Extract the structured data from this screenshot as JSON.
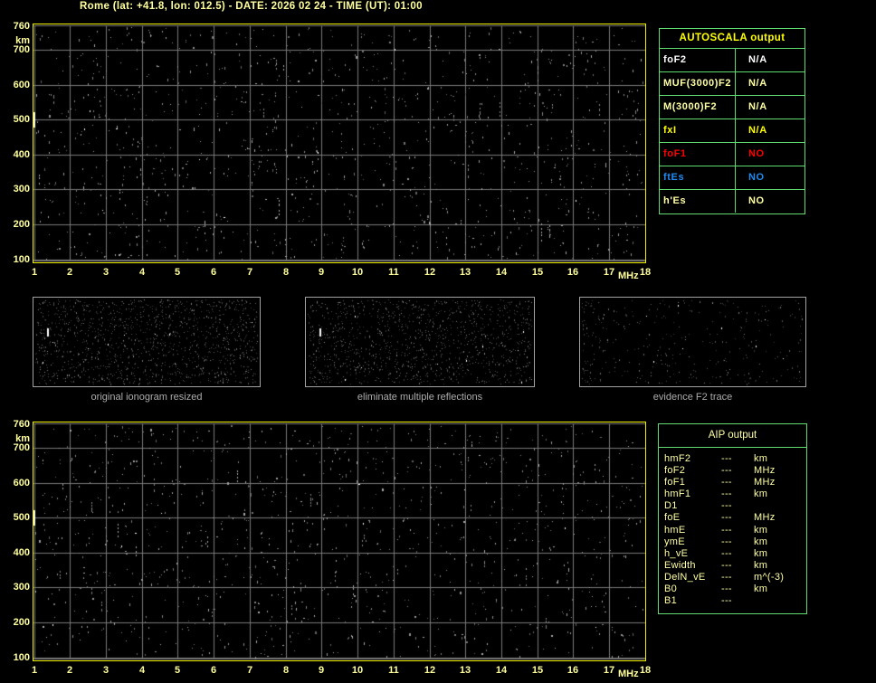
{
  "window": {
    "title": "Rome (lat: +41.8, lon: 012.5) - DATE: 2026 02 24 - TIME (UT): 01:00",
    "background": "#000000"
  },
  "colors": {
    "title_yellow": "#ffff9c",
    "axis_yellow": "#ffff9c",
    "plot_border_yellow": "#f2f200",
    "grid_gray": "#7a7a7a",
    "table_border_green": "#5fdb6f",
    "bright_yellow": "#ffff00",
    "pale_yellow": "#ffffa4",
    "white": "#ffffff",
    "red": "#ff0000",
    "blue": "#1e8cf0",
    "panel_gray": "#a2a2a2",
    "panel_label_gray": "#adadad"
  },
  "chart_data": [
    {
      "name": "top_ionogram",
      "type": "scatter",
      "title": "",
      "xlabel": "MHz",
      "ylabel": "km",
      "x_ticks": [
        1,
        2,
        3,
        4,
        5,
        6,
        7,
        8,
        9,
        10,
        11,
        12,
        13,
        14,
        15,
        16,
        17,
        18
      ],
      "y_ticks": [
        760,
        700,
        600,
        500,
        400,
        300,
        200,
        100
      ],
      "xlim": [
        1,
        18
      ],
      "ylim_km": [
        90,
        768
      ],
      "grid": true,
      "content": "random receiver noise echoes, no identifiable ionospheric trace",
      "noise": {
        "seed": 20260224,
        "count": 1150,
        "streaks": 26,
        "bright": 10
      }
    },
    {
      "name": "bottom_ionogram",
      "type": "scatter",
      "title": "",
      "xlabel": "MHz",
      "ylabel": "km",
      "x_ticks": [
        1,
        2,
        3,
        4,
        5,
        6,
        7,
        8,
        9,
        10,
        11,
        12,
        13,
        14,
        15,
        16,
        17,
        18
      ],
      "y_ticks": [
        760,
        700,
        600,
        500,
        400,
        300,
        200,
        100
      ],
      "xlim": [
        1,
        18
      ],
      "ylim_km": [
        90,
        768
      ],
      "grid": true,
      "content": "random receiver noise echoes, no identifiable ionospheric trace",
      "noise": {
        "seed": 77130355,
        "count": 1100,
        "streaks": 24,
        "bright": 9
      }
    }
  ],
  "autoscala_table": {
    "title": "AUTOSCALA output",
    "rows": [
      {
        "param": "foF2",
        "value": "N/A",
        "color": "#ffffff"
      },
      {
        "param": "MUF(3000)F2",
        "value": "N/A",
        "color": "#ffffa4"
      },
      {
        "param": "M(3000)F2",
        "value": "N/A",
        "color": "#ffffa4"
      },
      {
        "param": "fxI",
        "value": "N/A",
        "color": "#ffff00"
      },
      {
        "param": "foF1",
        "value": "NO",
        "color": "#ff0000"
      },
      {
        "param": "ftEs",
        "value": "NO",
        "color": "#1e8cf0"
      },
      {
        "param": "h'Es",
        "value": "NO",
        "color": "#ffffa4"
      }
    ]
  },
  "panels": [
    {
      "label": "original ionogram resized",
      "noise": {
        "seed": 1111,
        "count": 1250,
        "bright": 11
      }
    },
    {
      "label": "eliminate multiple reflections",
      "noise": {
        "seed": 2222,
        "count": 1150,
        "bright": 10
      }
    },
    {
      "label": "evidence F2 trace",
      "noise": {
        "seed": 3333,
        "count": 330,
        "bright": 8,
        "left_bias": true
      }
    }
  ],
  "aip_table": {
    "title": "AIP output",
    "rows": [
      {
        "param": "hmF2",
        "value": "---",
        "unit": "km"
      },
      {
        "param": "foF2",
        "value": "---",
        "unit": "MHz"
      },
      {
        "param": "foF1",
        "value": "---",
        "unit": "MHz"
      },
      {
        "param": "hmF1",
        "value": "---",
        "unit": "km"
      },
      {
        "param": "D1",
        "value": "---",
        "unit": ""
      },
      {
        "param": "foE",
        "value": "---",
        "unit": "MHz"
      },
      {
        "param": "hmE",
        "value": "---",
        "unit": "km"
      },
      {
        "param": "ymE",
        "value": "---",
        "unit": "km"
      },
      {
        "param": "h_vE",
        "value": "---",
        "unit": "km"
      },
      {
        "param": "Ewidth",
        "value": "---",
        "unit": "km"
      },
      {
        "param": "DelN_vE",
        "value": "---",
        "unit": "m^(-3)"
      },
      {
        "param": "B0",
        "value": "---",
        "unit": "km"
      },
      {
        "param": "B1",
        "value": "---",
        "unit": ""
      }
    ]
  }
}
